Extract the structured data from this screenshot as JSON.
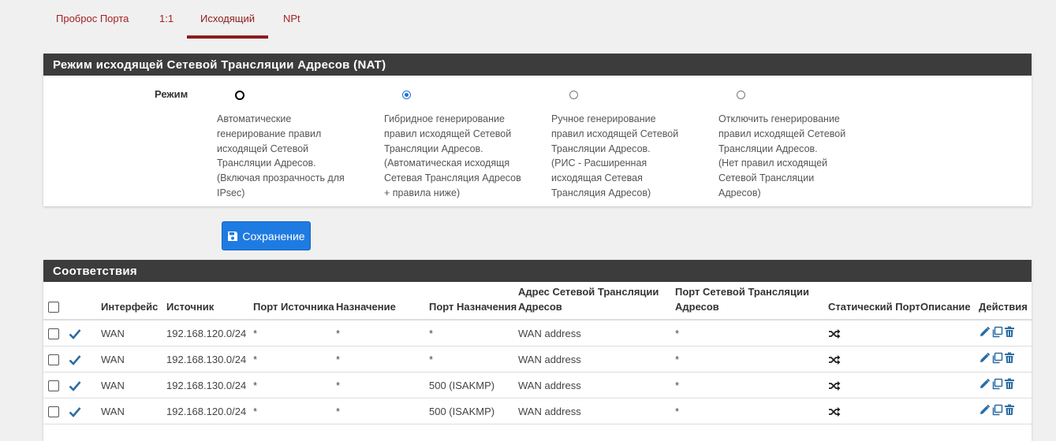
{
  "tabs": [
    {
      "label": "Проброс Порта"
    },
    {
      "label": "1:1"
    },
    {
      "label": "Исходящий"
    },
    {
      "label": "NPt"
    }
  ],
  "active_tab": "Исходящий",
  "mode_panel": {
    "title": "Режим исходящей Сетевой Трансляции Адресов (NAT)",
    "mode_label": "Режим",
    "options": [
      {
        "lines": [
          "Автоматические",
          "генерирование правил",
          "исходящей Сетевой",
          "Трансляции Адресов.",
          "(Включая прозрачность для",
          "IPsec)"
        ],
        "selected": false
      },
      {
        "lines": [
          "Гибридное генерирование",
          "правил исходящей Сетевой",
          "Трансляции Адресов.",
          "(Автоматическая исходящя",
          "Сетевая Трансляция Адресов",
          "+ правила ниже)"
        ],
        "selected": true
      },
      {
        "lines": [
          "Ручное генерирование",
          "правил исходящей Сетевой",
          "Трансляции Адресов.",
          "(РИС - Расширенная",
          "исходящая Сетевая",
          "Трансляция Адресов)"
        ],
        "selected": false
      },
      {
        "lines": [
          "Отключить генерирование",
          "правил исходящей Сетевой",
          "Трансляции Адресов.",
          "(Нет правил исходящей",
          "Сетевой Трансляции",
          "Адресов)"
        ],
        "selected": false
      }
    ]
  },
  "save_button": {
    "label": "Сохранение",
    "color": "#1e7be2"
  },
  "mappings": {
    "title": "Соответствия",
    "columns": [
      {
        "key": "check",
        "label": ""
      },
      {
        "key": "status",
        "label": ""
      },
      {
        "key": "interface",
        "label": "Интерфейс"
      },
      {
        "key": "source",
        "label": "Источник"
      },
      {
        "key": "source_port",
        "label": "Порт Источника"
      },
      {
        "key": "destination",
        "label": "Назначение"
      },
      {
        "key": "dest_port",
        "label": "Порт Назначения"
      },
      {
        "key": "nat_address",
        "label": "Адрес Сетевой Трансляции Адресов"
      },
      {
        "key": "nat_port",
        "label": "Порт Сетевой Трансляции Адресов"
      },
      {
        "key": "static_port",
        "label": "Статический Порт"
      },
      {
        "key": "description",
        "label": "Описание"
      },
      {
        "key": "actions",
        "label": "Действия"
      }
    ],
    "rows": [
      {
        "interface": "WAN",
        "source": "192.168.120.0/24",
        "source_port": "*",
        "destination": "*",
        "dest_port": "*",
        "nat_address": "WAN address",
        "nat_port": "*",
        "description": ""
      },
      {
        "interface": "WAN",
        "source": "192.168.130.0/24",
        "source_port": "*",
        "destination": "*",
        "dest_port": "*",
        "nat_address": "WAN address",
        "nat_port": "*",
        "description": ""
      },
      {
        "interface": "WAN",
        "source": "192.168.130.0/24",
        "source_port": "*",
        "destination": "*",
        "dest_port": "500 (ISAKMP)",
        "nat_address": "WAN address",
        "nat_port": "*",
        "description": ""
      },
      {
        "interface": "WAN",
        "source": "192.168.120.0/24",
        "source_port": "*",
        "destination": "*",
        "dest_port": "500 (ISAKMP)",
        "nat_address": "WAN address",
        "nat_port": "*",
        "description": ""
      }
    ],
    "icons": {
      "status": "check-icon",
      "static_port": "shuffle-icon",
      "edit": "pencil-icon",
      "copy": "copy-icon",
      "delete": "trash-icon"
    }
  },
  "colors": {
    "accent": "#8e1c1c",
    "panel_header": "#3c3c3c",
    "icon_blue": "#2b6ca3",
    "radio_blue": "#1e72d6"
  }
}
